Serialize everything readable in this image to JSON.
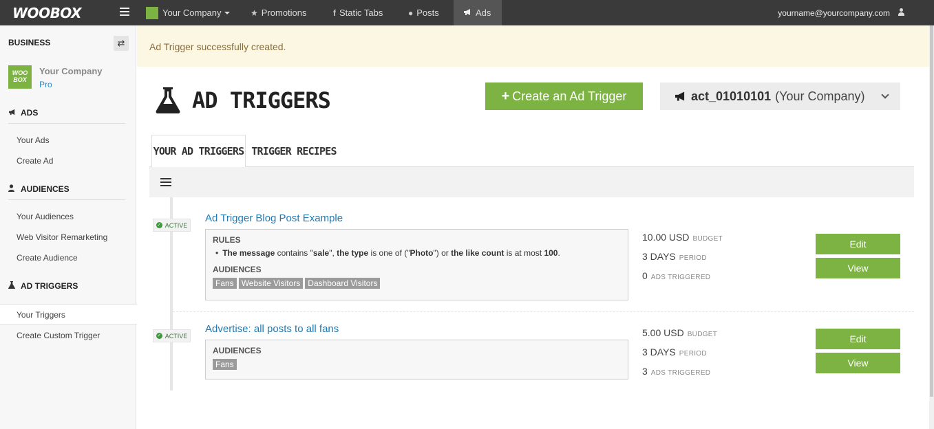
{
  "topnav": {
    "logo": "WOOBOX",
    "company": "Your Company",
    "items": [
      {
        "label": "Promotions"
      },
      {
        "label": "Static Tabs"
      },
      {
        "label": "Posts"
      },
      {
        "label": "Ads"
      }
    ],
    "user_email": "yourname@yourcompany.com"
  },
  "sidebar": {
    "business_label": "BUSINESS",
    "logo_text": "WOO BOX",
    "company_name": "Your Company",
    "plan": "Pro",
    "sections": [
      {
        "title": "ADS",
        "links": [
          "Your Ads",
          "Create Ad"
        ]
      },
      {
        "title": "AUDIENCES",
        "links": [
          "Your Audiences",
          "Web Visitor Remarketing",
          "Create Audience"
        ]
      },
      {
        "title": "AD TRIGGERS",
        "links": [
          "Your Triggers",
          "Create Custom Trigger"
        ]
      }
    ]
  },
  "alert": {
    "message": "Ad Trigger successfully created."
  },
  "header": {
    "title": "AD TRIGGERS",
    "create_button": "Create an Ad Trigger",
    "account_id": "act_01010101",
    "account_name": "(Your Company)"
  },
  "tabs": [
    {
      "label": "YOUR AD TRIGGERS"
    },
    {
      "label": "TRIGGER RECIPES"
    }
  ],
  "triggers": [
    {
      "status": "ACTIVE",
      "title": "Ad Trigger Blog Post Example",
      "rules_label": "RULES",
      "rule": {
        "p1": "The message",
        "p2": " contains \"",
        "p3": "sale",
        "p4": "\", ",
        "p5": "the type",
        "p6": " is one of (\"",
        "p7": "Photo",
        "p8": "\") or ",
        "p9": "the like count",
        "p10": " is at most ",
        "p11": "100",
        "p12": "."
      },
      "audiences_label": "AUDIENCES",
      "audiences": [
        "Fans",
        "Website Visitors",
        "Dashboard Visitors"
      ],
      "budget": "10.00 USD",
      "budget_label": "BUDGET",
      "period": "3 DAYS",
      "period_label": "PERIOD",
      "ads_triggered": "0",
      "ads_triggered_label": "ADS TRIGGERED",
      "edit_label": "Edit",
      "view_label": "View"
    },
    {
      "status": "ACTIVE",
      "title": "Advertise: all posts to all fans",
      "audiences_label": "AUDIENCES",
      "audiences": [
        "Fans"
      ],
      "budget": "5.00 USD",
      "budget_label": "BUDGET",
      "period": "3 DAYS",
      "period_label": "PERIOD",
      "ads_triggered": "3",
      "ads_triggered_label": "ADS TRIGGERED",
      "edit_label": "Edit",
      "view_label": "View"
    }
  ]
}
